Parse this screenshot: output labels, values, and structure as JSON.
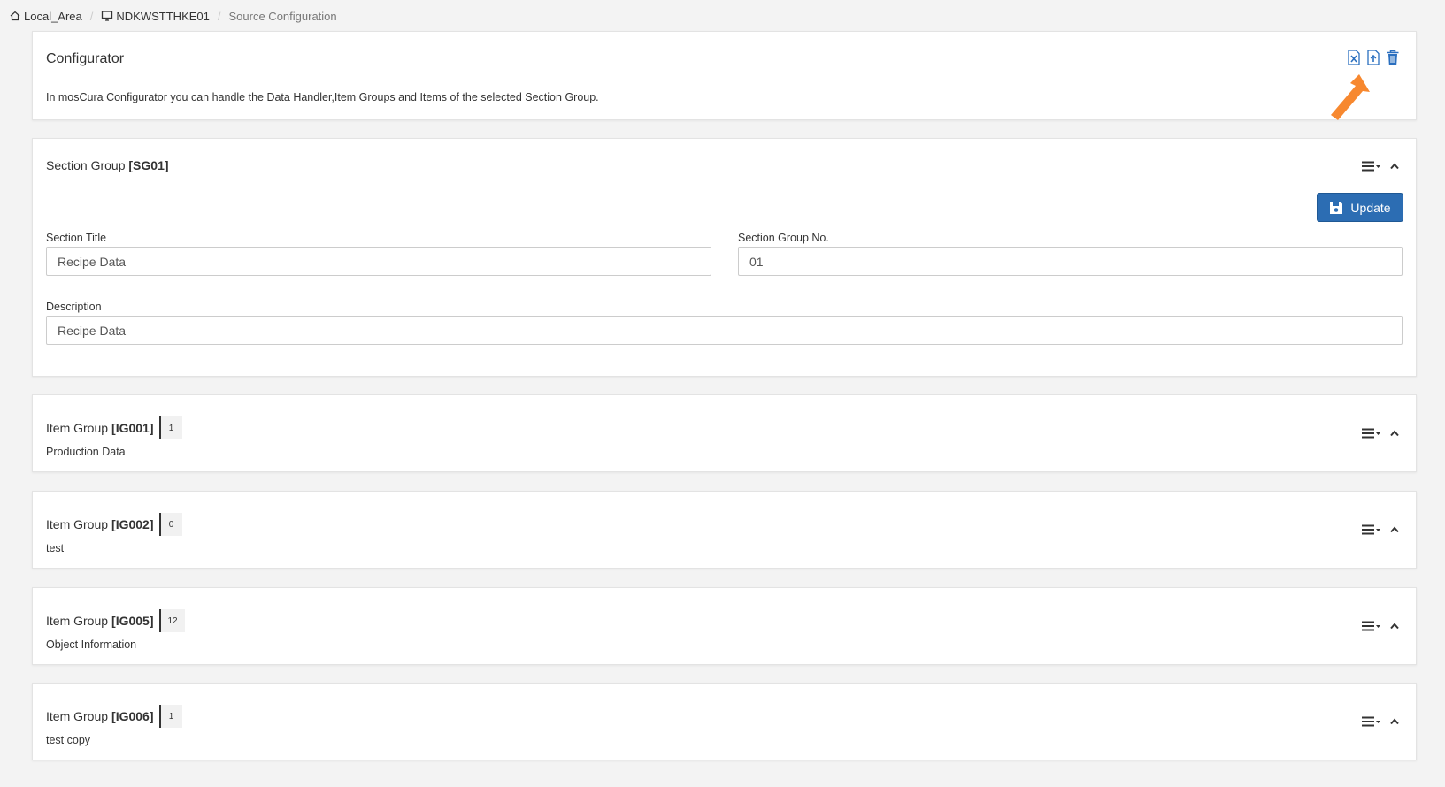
{
  "breadcrumb": {
    "items": [
      {
        "label": "Local_Area",
        "icon": "home-icon"
      },
      {
        "label": "NDKWSTTHKE01",
        "icon": "monitor-icon"
      },
      {
        "label": "Source Configuration"
      }
    ],
    "separator": "/"
  },
  "configurator": {
    "title": "Configurator",
    "description": "In mosCura Configurator you can handle the Data Handler,Item Groups and Items of the selected Section Group.",
    "tools": [
      "excel-export-icon",
      "file-upload-icon",
      "trash-icon"
    ]
  },
  "section_group": {
    "title_prefix": "Section Group",
    "code": "[SG01]",
    "update_label": "Update",
    "section_title_label": "Section Title",
    "section_title_value": "Recipe Data",
    "section_no_label": "Section Group No.",
    "section_no_value": "01",
    "description_label": "Description",
    "description_value": "Recipe Data"
  },
  "item_groups": [
    {
      "prefix": "Item Group",
      "code": "[IG001]",
      "count": "1",
      "subtitle": "Production Data"
    },
    {
      "prefix": "Item Group",
      "code": "[IG002]",
      "count": "0",
      "subtitle": "test"
    },
    {
      "prefix": "Item Group",
      "code": "[IG005]",
      "count": "12",
      "subtitle": "Object Information"
    },
    {
      "prefix": "Item Group",
      "code": "[IG006]",
      "count": "1",
      "subtitle": "test copy"
    }
  ],
  "colors": {
    "accent": "#2c6db3",
    "icon_blue": "#2a6fbf",
    "arrow_orange": "#f7882f",
    "background": "#f3f3f3"
  }
}
